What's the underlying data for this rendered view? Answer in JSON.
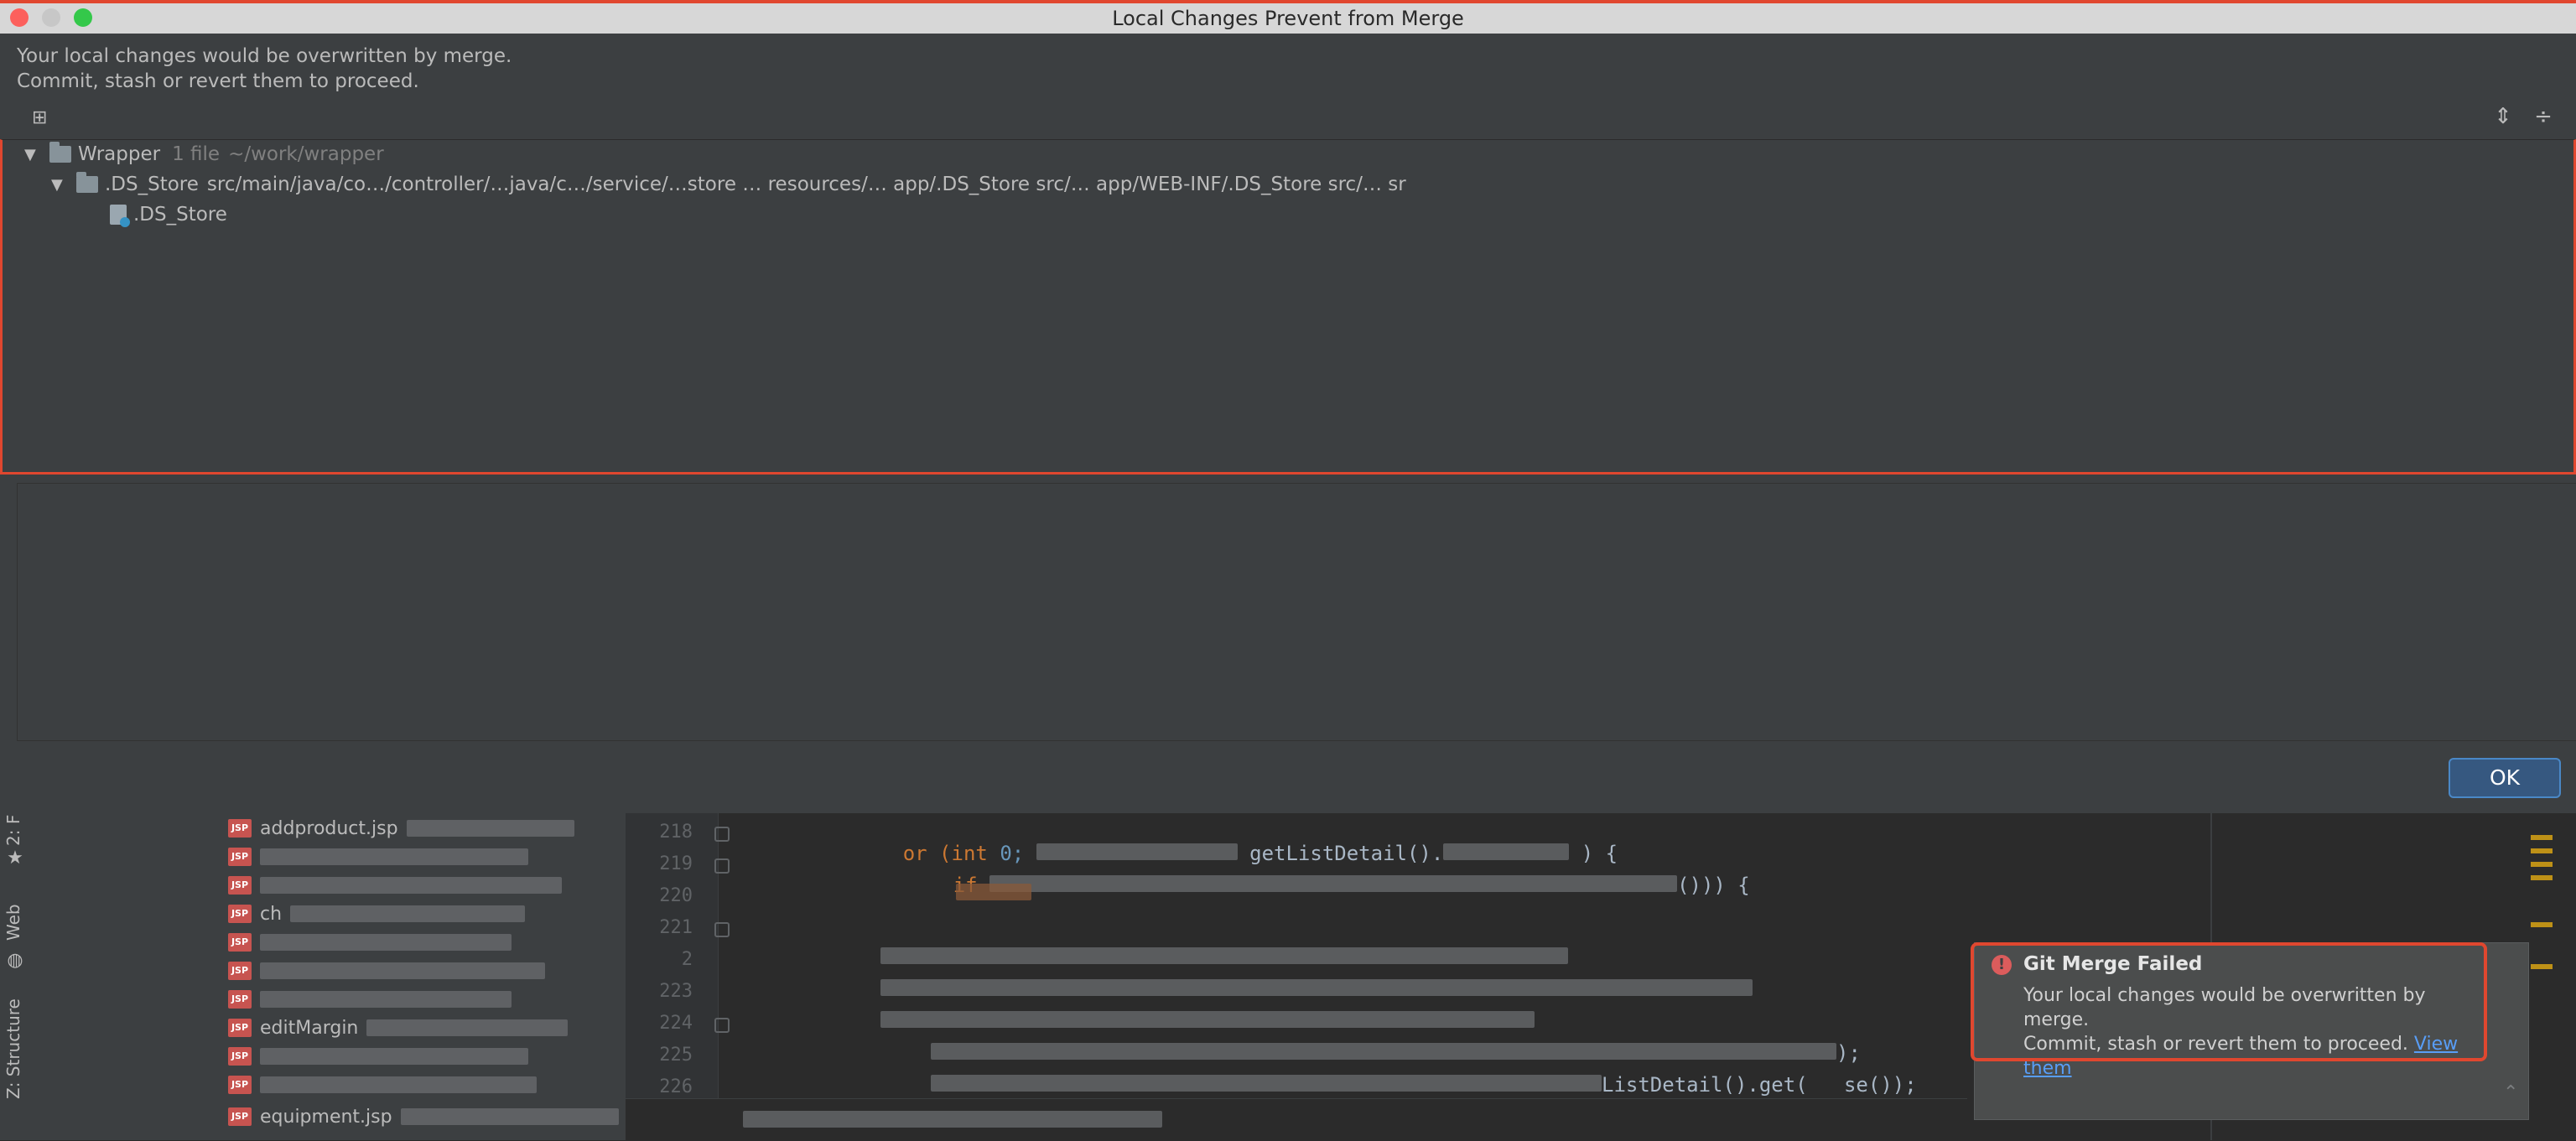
{
  "dialog": {
    "title": "Local Changes Prevent from Merge",
    "message_line1": "Your local changes would be overwritten by merge.",
    "message_line2": "Commit, stash or revert them to proceed.",
    "ok_label": "OK"
  },
  "tree": {
    "root": {
      "name": "Wrapper",
      "count": "1 file",
      "path": "~/work/wrapper"
    },
    "group": {
      "name": ".DS_Store",
      "path": "src/main/java/co…/controller/…java/c…/service/…store … resources/… app/.DS_Store src/… app/WEB-INF/.DS_Store src/… sr"
    },
    "file": {
      "name": ".DS_Store"
    }
  },
  "ide": {
    "tool_tabs": [
      "2: F",
      "Web",
      "Z: Structure"
    ],
    "files": [
      "addproduct.jsp",
      "ch",
      "editMargin",
      "equipment.jsp"
    ],
    "line_numbers": [
      "218",
      "219",
      "220",
      "221",
      "2",
      "223",
      "224",
      "225",
      "226"
    ],
    "code": {
      "l218_kw": "or (int",
      "l218_num": "0;",
      "l218_rest": "getListDetail().",
      "l218_end": ") {",
      "l219_kw": "if",
      "l219_end": "())) {",
      "l225_end": ");",
      "l226_end": "ListDetail().get(   se());"
    }
  },
  "notification": {
    "title": "Git Merge Failed",
    "body_line1": "Your local changes would be overwritten by merge.",
    "body_line2": "Commit, stash or revert them to proceed.",
    "link_label": "View them"
  },
  "colors": {
    "accent_red": "#e0472f",
    "ok_button": "#365880",
    "link": "#589df6",
    "error": "#db5c5c"
  }
}
